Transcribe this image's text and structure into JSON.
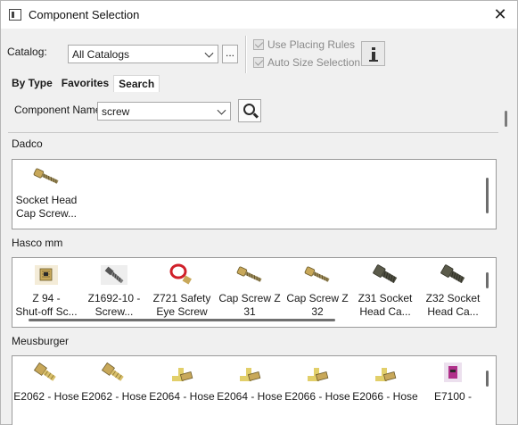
{
  "window": {
    "title": "Component Selection"
  },
  "toolbar": {
    "catalog_label": "Catalog:",
    "catalog_value": "All Catalogs",
    "ellipsis_label": "...",
    "use_placing_rules": "Use Placing Rules",
    "auto_size_selection": "Auto Size Selection"
  },
  "tabs": [
    {
      "label": "By Type"
    },
    {
      "label": "Favorites"
    },
    {
      "label": "Search"
    }
  ],
  "search": {
    "component_name_label": "Component Name:",
    "component_name_value": "screw"
  },
  "sections": [
    {
      "title": "Dadco",
      "items": [
        {
          "label": "Socket Head\nCap Screw...",
          "icon": "cap-screw-icon"
        }
      ]
    },
    {
      "title": "Hasco mm",
      "items": [
        {
          "label": "Z 94 -\nShut-off Sc...",
          "icon": "shutoff-screw-icon"
        },
        {
          "label": "Z1692-10 -\nScrew...",
          "icon": "screw-icon"
        },
        {
          "label": "Z721 Safety\nEye Screw",
          "icon": "eye-screw-icon"
        },
        {
          "label": "Cap Screw Z\n31",
          "icon": "cap-screw-icon"
        },
        {
          "label": "Cap Screw Z\n32",
          "icon": "cap-screw-icon"
        },
        {
          "label": "Z31 Socket\nHead Ca...",
          "icon": "socket-head-icon"
        },
        {
          "label": "Z32 Socket\nHead Ca...",
          "icon": "socket-head-icon"
        }
      ]
    },
    {
      "title": "Meusburger",
      "items": [
        {
          "label": "E2062 - Hose",
          "icon": "hose-fitting-icon"
        },
        {
          "label": "E2062 - Hose",
          "icon": "hose-fitting-icon"
        },
        {
          "label": "E2064 - Hose",
          "icon": "hose-elbow-icon"
        },
        {
          "label": "E2064 - Hose",
          "icon": "hose-elbow-icon"
        },
        {
          "label": "E2066 - Hose",
          "icon": "hose-elbow-icon"
        },
        {
          "label": "E2066 - Hose",
          "icon": "hose-elbow-icon"
        },
        {
          "label": "E7100 -",
          "icon": "plug-icon"
        }
      ]
    }
  ],
  "colors": {
    "brass": "#c8a85a",
    "steel": "#7d7d7d",
    "red": "#d0202a",
    "magenta": "#b0308a"
  }
}
